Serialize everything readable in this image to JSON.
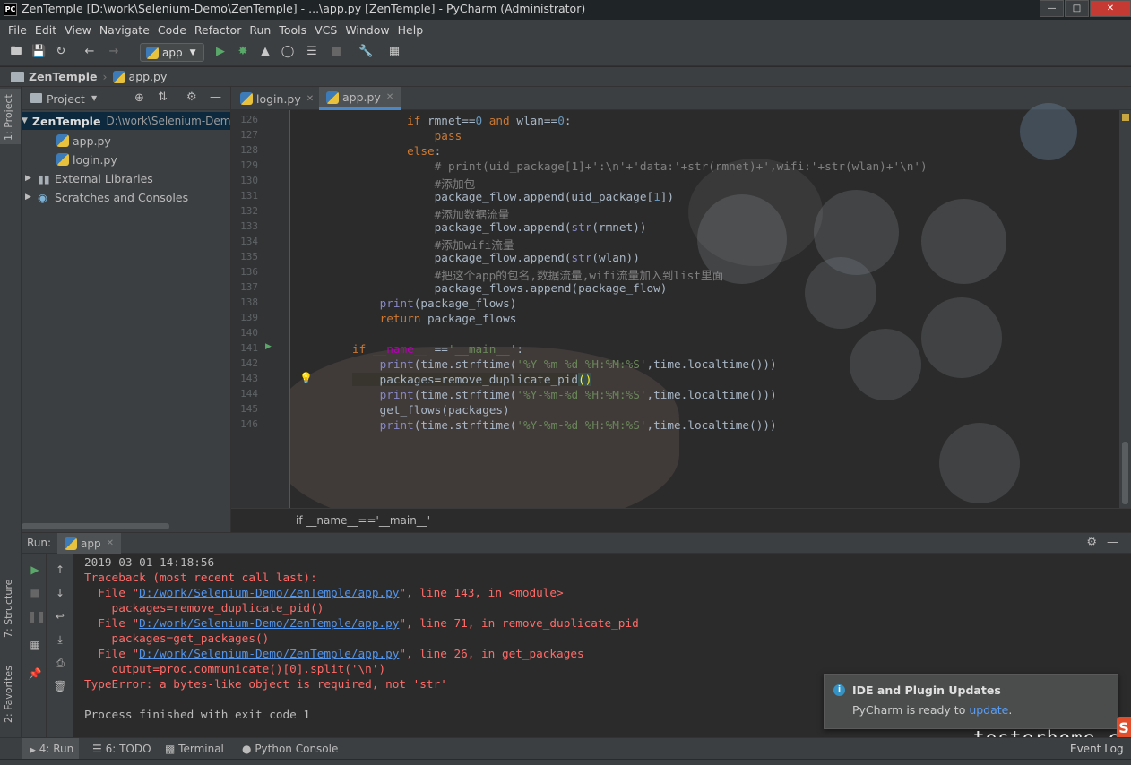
{
  "window": {
    "title": "ZenTemple [D:\\work\\Selenium-Demo\\ZenTemple] - ...\\app.py [ZenTemple] - PyCharm (Administrator)",
    "logo": "PC"
  },
  "menu": [
    "File",
    "Edit",
    "View",
    "Navigate",
    "Code",
    "Refactor",
    "Run",
    "Tools",
    "VCS",
    "Window",
    "Help"
  ],
  "toolbar": {
    "run_config": "app"
  },
  "navbar": {
    "project": "ZenTemple",
    "file": "app.py"
  },
  "left_strip": {
    "project_tab": "1: Project",
    "structure_tab": "7: Structure",
    "favorites_tab": "2: Favorites"
  },
  "project": {
    "header": "Project",
    "root_name": "ZenTemple",
    "root_path": "D:\\work\\Selenium-Demo\\ZenTemple",
    "files": [
      "app.py",
      "login.py"
    ],
    "external": "External Libraries",
    "scratches": "Scratches and Consoles"
  },
  "editor": {
    "tabs": [
      "login.py",
      "app.py"
    ],
    "breadcrumb": "if __name__=='__main__'"
  },
  "run": {
    "label": "Run:",
    "tab": "app",
    "output": [
      "2019-03-01 14:18:56",
      "Traceback (most recent call last):",
      "  File \"",
      "D:/work/Selenium-Demo/ZenTemple/app.py",
      "\", line 143, in <module>",
      "    packages=remove_duplicate_pid()",
      "\", line 71, in remove_duplicate_pid",
      "    packages=get_packages()",
      "\", line 26, in get_packages",
      "    output=proc.communicate()[0].split('\\n')",
      "TypeError: a bytes-like object is required, not 'str'",
      "Process finished with exit code 1"
    ]
  },
  "notification": {
    "title": "IDE and Plugin Updates",
    "text": "PyCharm is ready to ",
    "link": "update",
    "tail": "."
  },
  "bottom_tabs": [
    "4: Run",
    "6: TODO",
    "Terminal",
    "Python Console"
  ],
  "event_log": "Event Log",
  "watermark": "testerhome.com",
  "colors": {
    "keyword": "#cc7832",
    "string": "#6a8759",
    "comment": "#808080",
    "error": "#ff6b68",
    "link": "#5394ec",
    "accent": "#4a88c7"
  }
}
